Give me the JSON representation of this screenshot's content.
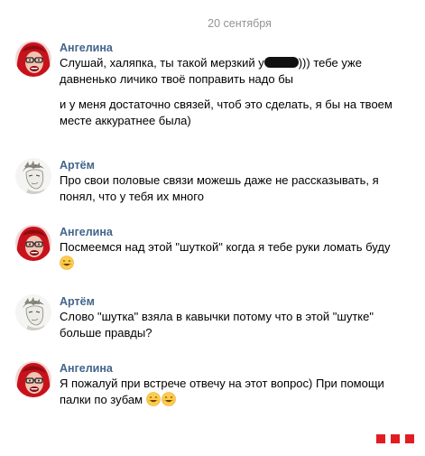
{
  "date_separator": "20 сентября",
  "messages": [
    {
      "author": "Ангелина",
      "avatar_icon": "angelina-avatar",
      "line1_before": "Слушай, халяпка, ты такой мерзкий у",
      "line1_after": "))) тебе уже",
      "line1_tail": "давненько личико твоё поправить надо бы",
      "line2": "и у меня достаточно связей, чтоб это сделать, я бы на твоем месте аккуратнее была)"
    },
    {
      "author": "Артём",
      "avatar_icon": "artem-avatar",
      "text": "Про свои половые связи можешь даже не рассказывать, я понял, что у тебя их много"
    },
    {
      "author": "Ангелина",
      "avatar_icon": "angelina-avatar",
      "text": "Посмеемся над этой \"шуткой\" когда я тебе руки ломать буду",
      "emoji_count": 1
    },
    {
      "author": "Артём",
      "avatar_icon": "artem-avatar",
      "text": "Слово \"шутка\" взяла в кавычки потому что в этой \"шутке\" больше правды?"
    },
    {
      "author": "Ангелина",
      "avatar_icon": "angelina-avatar",
      "text": "Я пожалуй при встрече отвечу на этот вопрос) При помощи палки по зубам",
      "emoji_count": 2
    }
  ],
  "colors": {
    "author": "#42648b",
    "date": "#939393",
    "watermark": "#e11d22"
  }
}
